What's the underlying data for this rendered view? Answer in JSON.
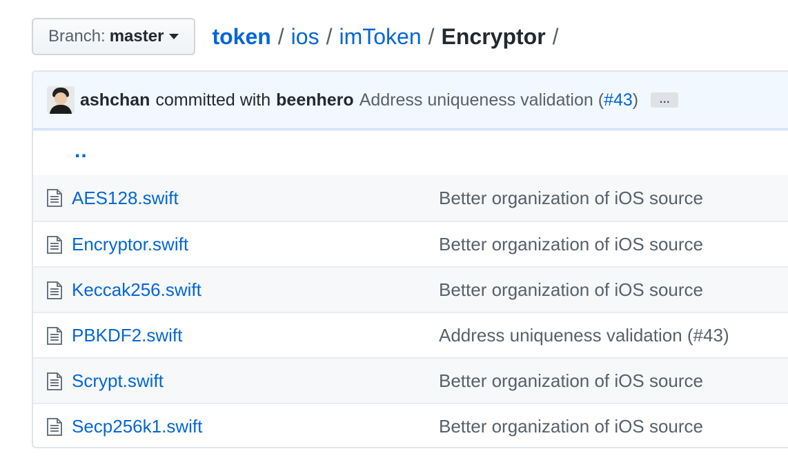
{
  "branch": {
    "prefix": "Branch:",
    "name": "master"
  },
  "breadcrumb": {
    "root": "token",
    "parts": [
      "ios",
      "imToken"
    ],
    "current": "Encryptor",
    "separator": "/",
    "trailing_separator": "/"
  },
  "latest_commit": {
    "author": "ashchan",
    "with_text": "committed with",
    "committer": "beenhero",
    "message_prefix": "Address uniqueness validation (",
    "issue_ref": "#43",
    "message_suffix": ")",
    "ellipsis": "…"
  },
  "parent_dir": "..",
  "files": [
    {
      "name": "AES128.swift",
      "commit": "Better organization of iOS source"
    },
    {
      "name": "Encryptor.swift",
      "commit": "Better organization of iOS source"
    },
    {
      "name": "Keccak256.swift",
      "commit": "Better organization of iOS source"
    },
    {
      "name": "PBKDF2.swift",
      "commit": "Address uniqueness validation (#43)"
    },
    {
      "name": "Scrypt.swift",
      "commit": "Better organization of iOS source"
    },
    {
      "name": "Secp256k1.swift",
      "commit": "Better organization of iOS source"
    }
  ],
  "colors": {
    "link": "#0366d6",
    "commit_bar_bg": "#f1f8ff",
    "muted_text": "#586069"
  }
}
